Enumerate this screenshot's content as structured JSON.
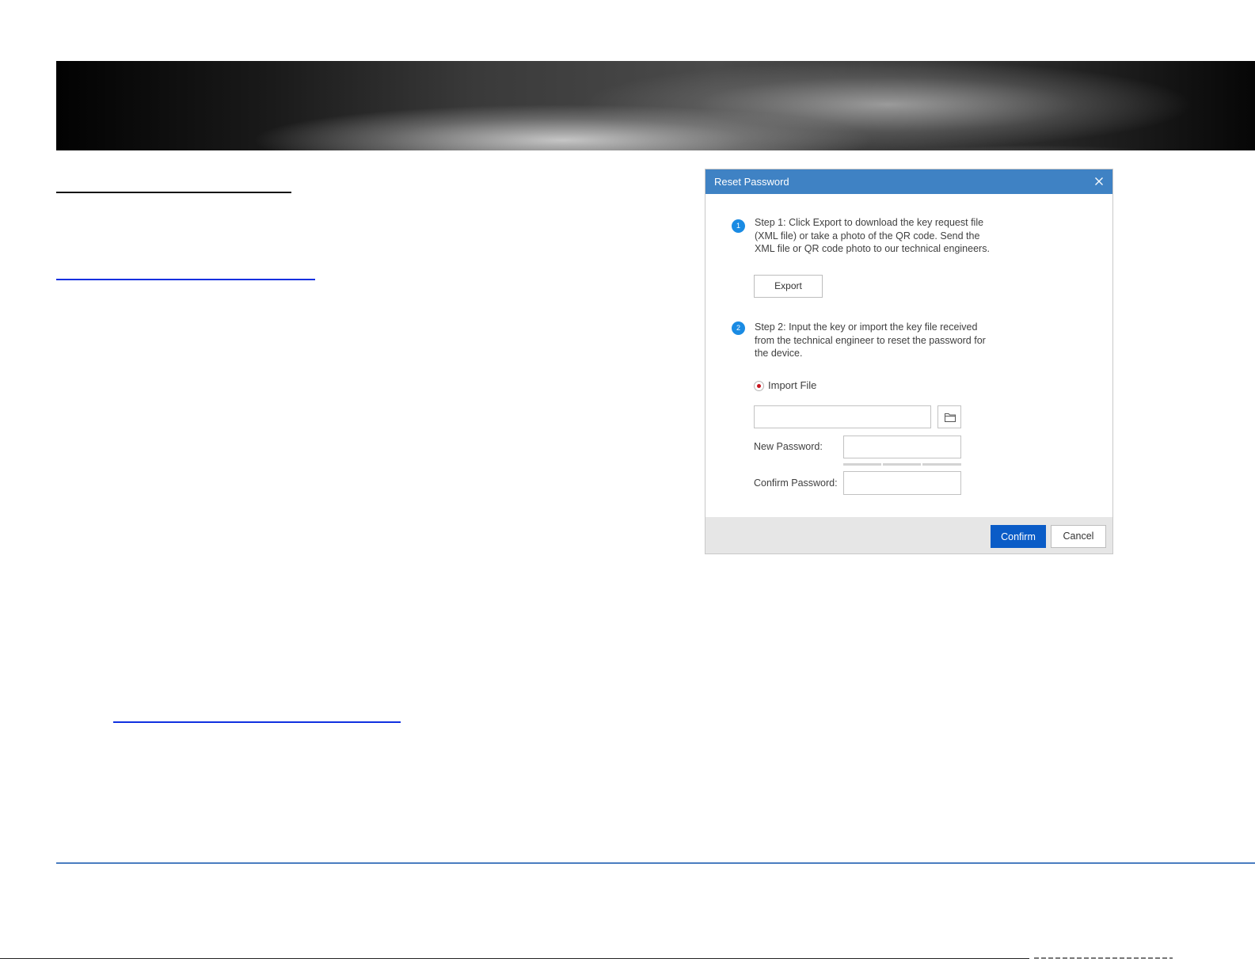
{
  "dialog": {
    "title": "Reset Password",
    "step1": {
      "badge": "1",
      "text": "Step 1: Click Export to download the key request file (XML file) or take a photo of the QR code. Send the XML file or QR code photo to our technical engineers.",
      "export_label": "Export"
    },
    "step2": {
      "badge": "2",
      "text": "Step 2: Input the key or import the key file received from the technical engineer to reset the password for the device.",
      "import_option_label": "Import File",
      "import_option_selected": true,
      "file_path_value": "",
      "new_password_label": "New Password:",
      "new_password_value": "",
      "confirm_password_label": "Confirm Password:",
      "confirm_password_value": ""
    },
    "footer": {
      "confirm_label": "Confirm",
      "cancel_label": "Cancel"
    }
  },
  "icons": {
    "close": "close-icon",
    "browse": "folder-icon"
  },
  "colors": {
    "dialog_header": "#3f82c4",
    "step_badge": "#1a8be3",
    "confirm_button": "#0a5cc7",
    "radio_selected": "#c8141e",
    "link_rule": "#1030e0",
    "footer_rule": "#4a7dc0"
  }
}
